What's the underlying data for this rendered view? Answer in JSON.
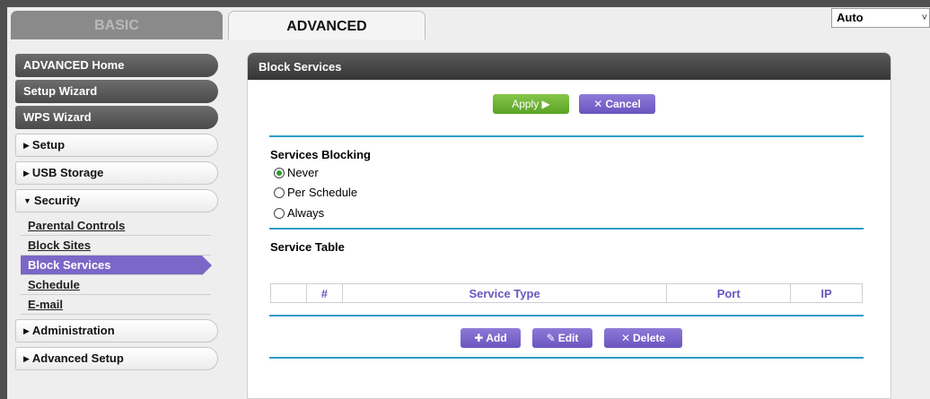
{
  "tabs": {
    "basic": "BASIC",
    "advanced": "ADVANCED"
  },
  "language_select": {
    "value": "Auto",
    "chevron": "˅"
  },
  "sidebar": {
    "advanced_home": "ADVANCED Home",
    "setup_wizard": "Setup Wizard",
    "wps_wizard": "WPS Wizard",
    "setup": "Setup",
    "usb_storage": "USB Storage",
    "security": "Security",
    "security_items": [
      "Parental Controls",
      "Block Sites",
      "Block Services",
      "Schedule",
      "E-mail"
    ],
    "administration": "Administration",
    "advanced_setup": "Advanced Setup"
  },
  "panel": {
    "title": "Block Services",
    "apply_label": "Apply ▶",
    "cancel_label": "Cancel",
    "services_blocking": {
      "title": "Services Blocking",
      "options": [
        "Never",
        "Per Schedule",
        "Always"
      ],
      "selected": "Never"
    },
    "service_table": {
      "title": "Service Table",
      "headers": [
        "",
        "#",
        "Service Type",
        "Port",
        "IP"
      ]
    },
    "add_label": "Add",
    "edit_label": "Edit",
    "delete_label": "Delete"
  },
  "colors": {
    "accent_purple": "#6a55bf",
    "accent_green": "#5aa325",
    "rule_blue": "#2a9ec6"
  }
}
